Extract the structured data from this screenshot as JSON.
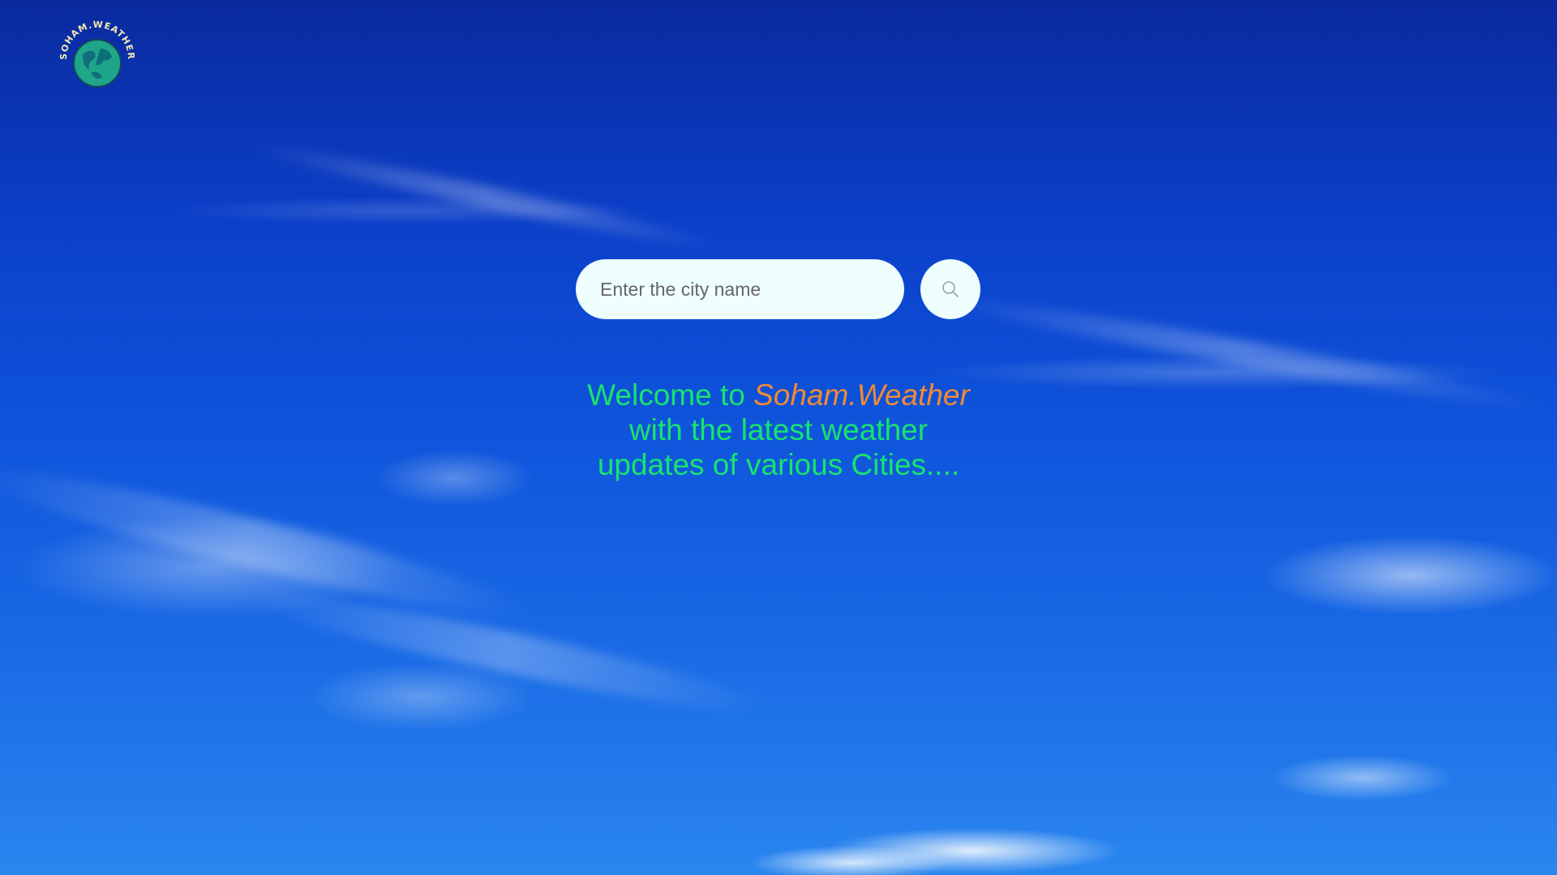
{
  "logo": {
    "text": "SOHAM.WEATHER"
  },
  "search": {
    "placeholder": "Enter the city name",
    "value": "",
    "button_icon": "search-icon"
  },
  "welcome": {
    "prefix": "Welcome to",
    "brand": "Soham.Weather",
    "line2": "with the latest weather",
    "line3": "updates of various Cities...."
  },
  "colors": {
    "welcome_text": "#17e36e",
    "brand_text": "#f08a34",
    "input_background": "#eefffe",
    "sky": "#0f55dc"
  }
}
